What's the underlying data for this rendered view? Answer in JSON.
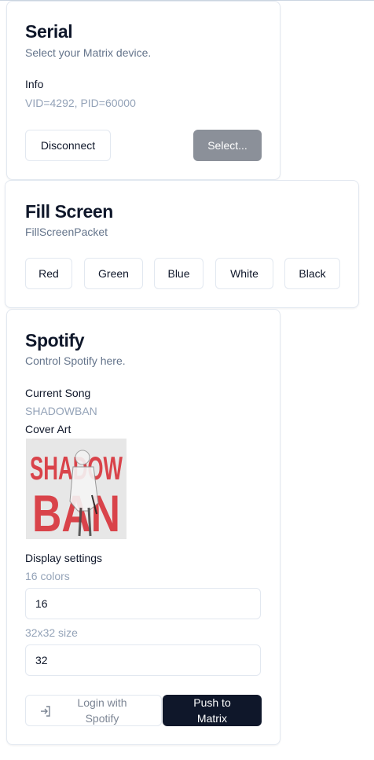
{
  "serial": {
    "title": "Serial",
    "description": "Select your Matrix device.",
    "info_label": "Info",
    "info_value": "VID=4292, PID=60000",
    "disconnect_label": "Disconnect",
    "select_label": "Select..."
  },
  "fill_screen": {
    "title": "Fill Screen",
    "description": "FillScreenPacket",
    "buttons": [
      "Red",
      "Green",
      "Blue",
      "White",
      "Black"
    ]
  },
  "spotify": {
    "title": "Spotify",
    "description": "Control Spotify here.",
    "current_song_label": "Current Song",
    "current_song_value": "SHADOWBAN",
    "cover_art_label": "Cover Art",
    "cover_art_text_top": "SHADOW",
    "cover_art_text_bottom": "BAN",
    "display_settings_label": "Display settings",
    "colors_label": "16 colors",
    "colors_value": "16",
    "size_label": "32x32 size",
    "size_value": "32",
    "login_label_line1": "Login with",
    "login_label_line2": "Spotify",
    "push_label_line1": "Push to",
    "push_label_line2": "Matrix"
  },
  "colors": {
    "cover_red": "#d9434a",
    "dark_button": "#0f172a",
    "select_button": "#8b9099"
  }
}
